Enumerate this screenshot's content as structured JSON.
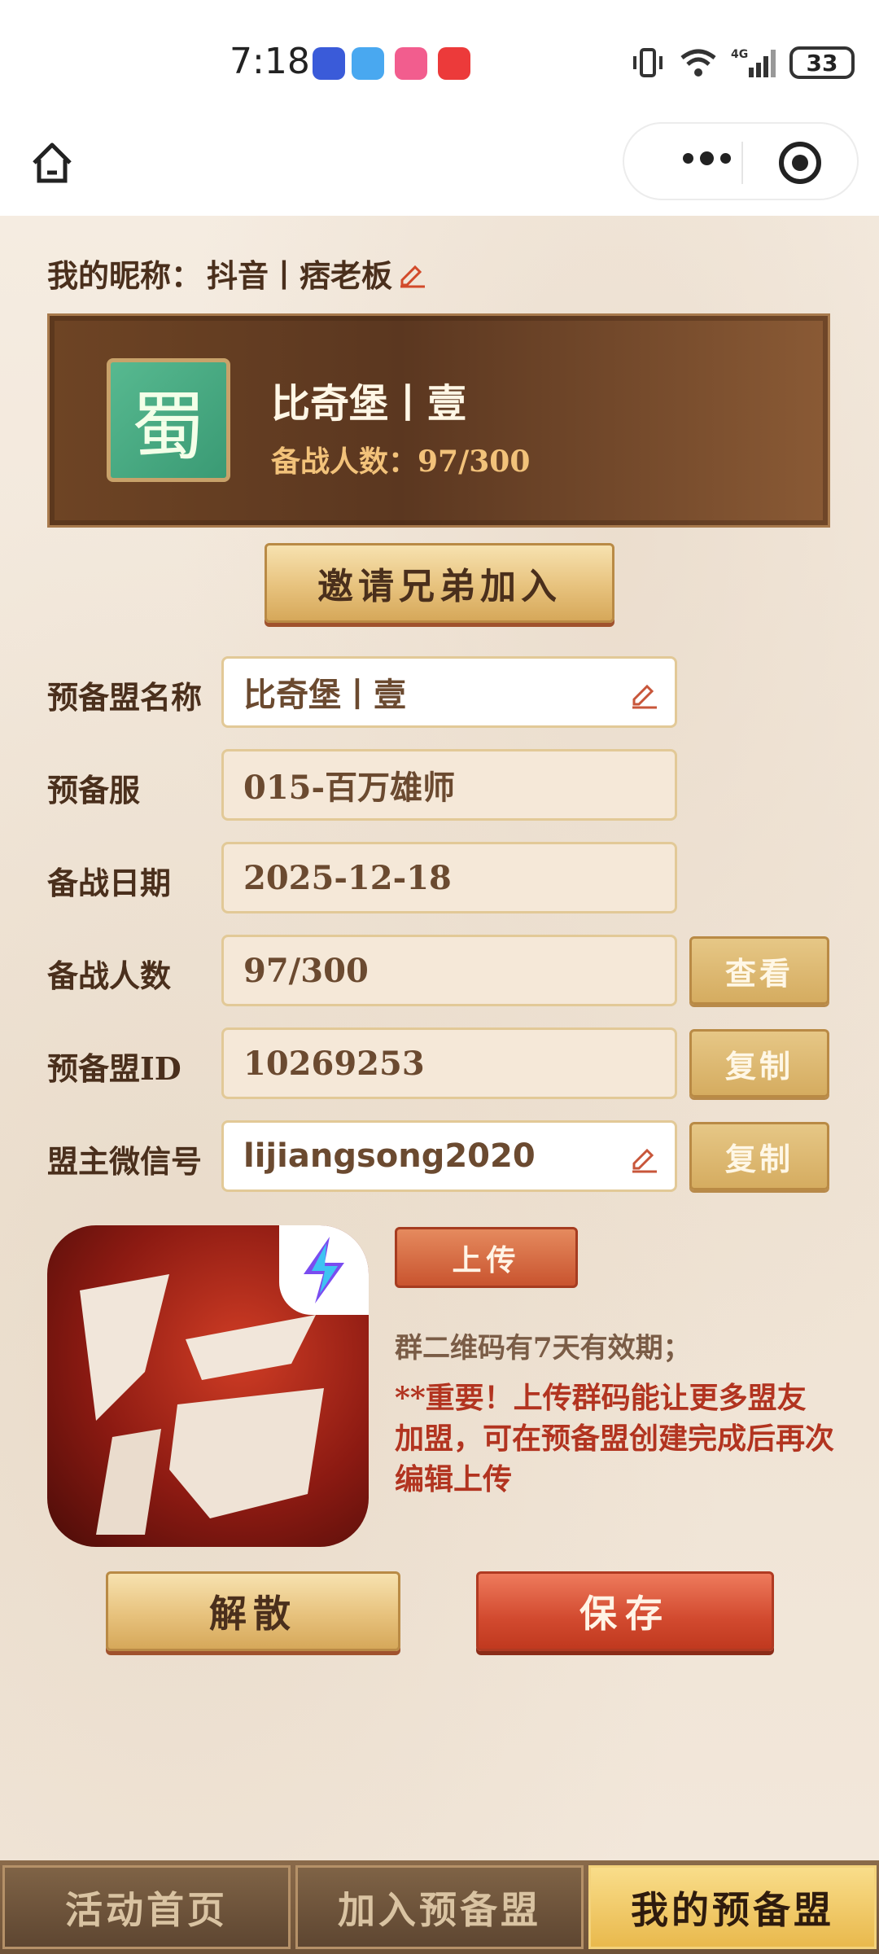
{
  "status_bar": {
    "time": "7:18",
    "battery": "33",
    "network": "4G"
  },
  "nav": {
    "home_icon": "home-icon",
    "more_icon": "more-dots-icon",
    "close_icon": "target-close-icon"
  },
  "profile": {
    "nickname_label": "我的昵称：",
    "nickname": "抖音丨痞老板"
  },
  "alliance_card": {
    "seal_text": "蜀",
    "name": "比奇堡丨壹",
    "count_label": "备战人数：97/300"
  },
  "invite_button": "邀请兄弟加入",
  "form": {
    "alliance_name": {
      "label": "预备盟名称",
      "value": "比奇堡丨壹"
    },
    "server": {
      "label": "预备服",
      "value": "015-百万雄师"
    },
    "date": {
      "label": "备战日期",
      "value": "2025-12-18"
    },
    "members": {
      "label": "备战人数",
      "value": "97/300",
      "button": "查看"
    },
    "alliance_id": {
      "label": "预备盟ID",
      "value": "10269253",
      "button": "复制"
    },
    "leader_wechat": {
      "label": "盟主微信号",
      "value": "lijiangsong2020",
      "button": "复制"
    }
  },
  "qr_section": {
    "upload_button": "上传",
    "note": "群二维码有7天有效期；",
    "warning": "**重要！上传群码能让更多盟友加盟，可在预备盟创建完成后再次编辑上传"
  },
  "actions": {
    "disband": "解散",
    "save": "保存"
  },
  "tabs": [
    {
      "label": "活动首页",
      "active": false
    },
    {
      "label": "加入预备盟",
      "active": false
    },
    {
      "label": "我的预备盟",
      "active": true
    }
  ],
  "colors": {
    "accent_red": "#c9542f",
    "gold": "#e7c27d",
    "text_brown": "#4a2f1c"
  }
}
